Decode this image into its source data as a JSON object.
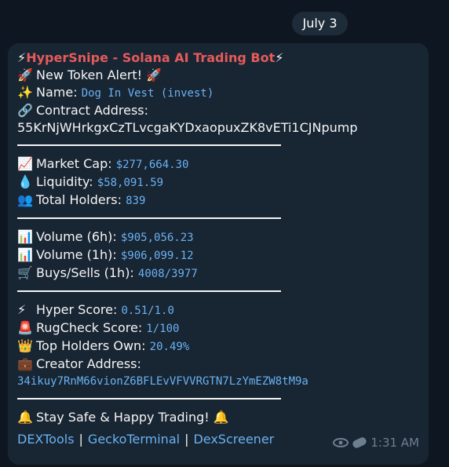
{
  "date": "July 3",
  "message": {
    "title_emoji_left": "⚡",
    "title": "HyperSnipe - Solana AI Trading Bot",
    "title_emoji_right": "⚡",
    "alert_emoji": "🚀",
    "alert": "New Token Alert!",
    "alert_emoji_right": "🚀",
    "name_emoji": "✨",
    "name_label": "Name: ",
    "name_value": "Dog In Vest (invest)",
    "contract_emoji": "🔗",
    "contract_label": "Contract Address:",
    "contract_value": "55KrNjWHrkgxCzTLvcgaKYDxaopuxZK8vETi1CJNpump",
    "market_cap_emoji": "📈",
    "market_cap_label": "Market Cap: ",
    "market_cap_value": "$277,664.30",
    "liquidity_emoji": "💧",
    "liquidity_label": "Liquidity: ",
    "liquidity_value": "$58,091.59",
    "holders_emoji": "👥",
    "holders_label": "Total Holders: ",
    "holders_value": "839",
    "vol6_emoji": "📊",
    "vol6_label": "Volume (6h): ",
    "vol6_value": "$905,056.23",
    "vol1_emoji": "📊",
    "vol1_label": "Volume (1h): ",
    "vol1_value": "$906,099.12",
    "buys_emoji": "🛒",
    "buys_label": "Buys/Sells (1h): ",
    "buys_value": "4008/3977",
    "hyper_emoji": "⚡",
    "hyper_label": "Hyper Score: ",
    "hyper_value": "0.51/1.0",
    "rug_emoji": "🚨",
    "rug_label": "RugCheck Score: ",
    "rug_value": "1/100",
    "top_emoji": "👑",
    "top_label": "Top Holders Own: ",
    "top_value": "20.49%",
    "creator_emoji": "💼",
    "creator_label": "Creator Address:",
    "creator_value": "34ikuy7RnM66vionZ6BFLEvVFVVRGTN7LzYmEZW8tM9a",
    "footer_emoji": "🔔",
    "footer": "Stay Safe & Happy Trading!",
    "footer_emoji_right": "🔔"
  },
  "links": {
    "dextools": "DEXTools",
    "sep1": "|",
    "gecko": "GeckoTerminal",
    "sep2": "|",
    "dexscreener": "DexScreener"
  },
  "meta": {
    "time": "1:31 AM",
    "views_icon": "eye-icon",
    "extra_icon": "pill-icon"
  },
  "colors": {
    "background": "#0e1621",
    "bubble": "#182533",
    "title": "#e55b5b",
    "link": "#6ab2f2",
    "meta": "#6d7f8f"
  }
}
